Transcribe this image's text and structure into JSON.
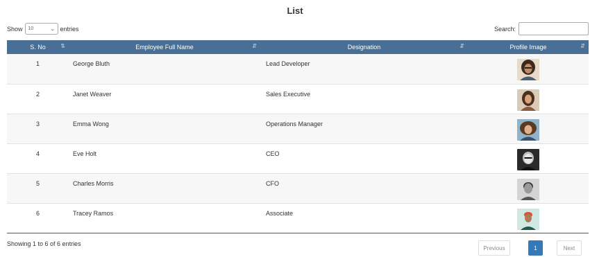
{
  "title": "List",
  "length_menu": {
    "show_label": "Show",
    "selected": "10",
    "entries_label": "entries"
  },
  "search": {
    "label": "Search:",
    "value": "",
    "placeholder": ""
  },
  "table": {
    "headers": [
      "S. No",
      "Employee Full Name",
      "Designation",
      "Profile Image"
    ],
    "rows": [
      {
        "no": "1",
        "name": "George Bluth",
        "designation": "Lead Developer",
        "avatar": "profile-photo-1"
      },
      {
        "no": "2",
        "name": "Janet Weaver",
        "designation": "Sales Executive",
        "avatar": "profile-photo-2"
      },
      {
        "no": "3",
        "name": "Emma Wong",
        "designation": "Operations Manager",
        "avatar": "profile-photo-3"
      },
      {
        "no": "4",
        "name": "Eve Holt",
        "designation": "CEO",
        "avatar": "profile-photo-4"
      },
      {
        "no": "5",
        "name": "Charles Morris",
        "designation": "CFO",
        "avatar": "profile-photo-5"
      },
      {
        "no": "6",
        "name": "Tracey Ramos",
        "designation": "Associate",
        "avatar": "profile-photo-6"
      }
    ]
  },
  "footer": {
    "info": "Showing 1 to 6 of 6 entries"
  },
  "pagination": {
    "previous": "Previous",
    "current_page": "1",
    "next": "Next"
  },
  "colors": {
    "header_bg": "#4a6f96",
    "page_active": "#337ab7"
  }
}
